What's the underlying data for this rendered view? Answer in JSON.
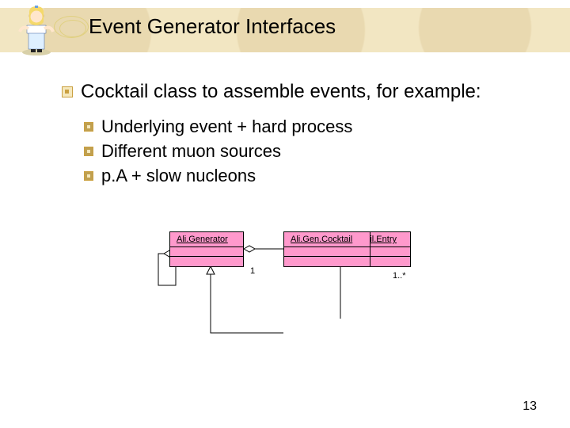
{
  "slide": {
    "title": "Event Generator Interfaces",
    "page_number": "13"
  },
  "bullets": {
    "main": "Cocktail class to assemble events, for example:",
    "subs": [
      "Underlying event + hard process",
      "Different muon sources",
      "p.A + slow nucleons"
    ]
  },
  "diagram": {
    "box1": "Ali.Generator",
    "box2": "Ali.Gen.Cocktail.Entry",
    "box3": "Ali.Gen.Cocktail",
    "mult1": "1",
    "mult2": "1..*"
  },
  "colors": {
    "band": "#f2e6c2",
    "uml": "#ff99cc",
    "accent": "#caa040"
  }
}
